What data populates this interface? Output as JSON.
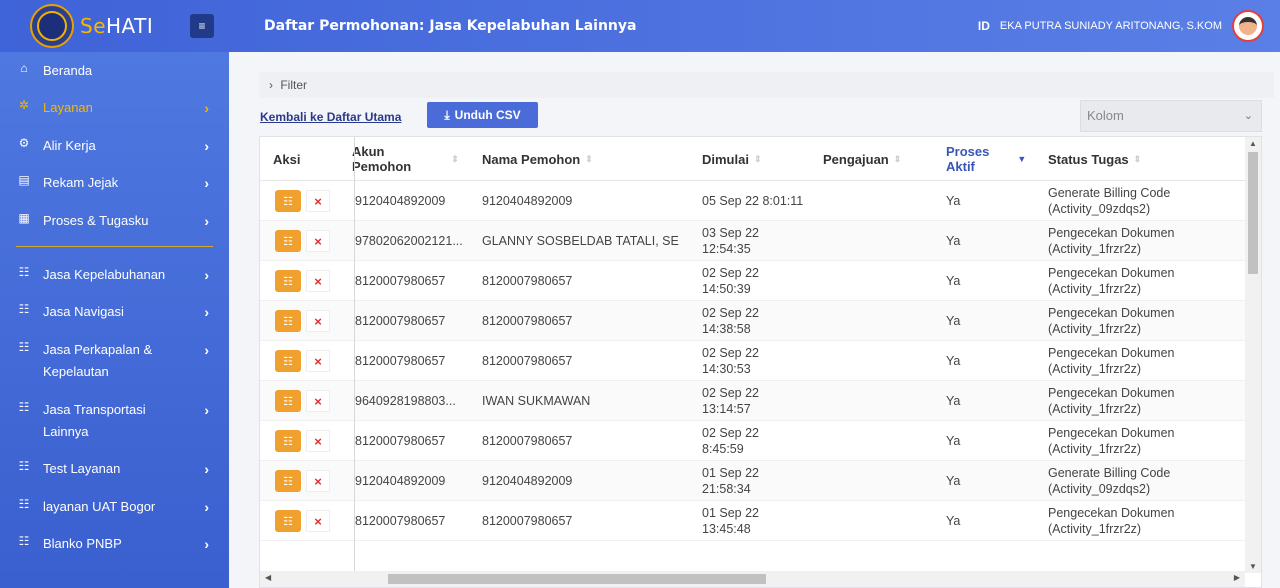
{
  "brand": {
    "prefix": "Se",
    "suffix": "HATI"
  },
  "header": {
    "title": "Daftar Permohonan: Jasa Kepelabuhan Lainnya",
    "lang": "ID",
    "user_name": "EKA PUTRA SUNIADY ARITONANG, S.KOM",
    "toggle_icon": "≡"
  },
  "sidebar": {
    "items": [
      {
        "label": "Beranda",
        "icon": "home-icon",
        "glyph": "⌂",
        "chevron": false
      },
      {
        "label": "Layanan",
        "icon": "spark-icon",
        "glyph": "✲",
        "chevron": true,
        "active": true
      },
      {
        "label": "Alir Kerja",
        "icon": "gear-icon",
        "glyph": "⚙",
        "chevron": true
      },
      {
        "label": "Rekam Jejak",
        "icon": "document-icon",
        "glyph": "▤",
        "chevron": true
      },
      {
        "label": "Proses & Tugasku",
        "icon": "calendar-icon",
        "glyph": "▦",
        "chevron": true
      },
      {
        "label": "Jasa Kepelabuhanan",
        "icon": "list-icon",
        "glyph": "☷",
        "chevron": true
      },
      {
        "label": "Jasa Navigasi",
        "icon": "list-icon",
        "glyph": "☷",
        "chevron": true
      },
      {
        "label": "Jasa Perkapalan & Kepelautan",
        "icon": "list-icon",
        "glyph": "☷",
        "chevron": true
      },
      {
        "label": "Jasa Transportasi Lainnya",
        "icon": "list-icon",
        "glyph": "☷",
        "chevron": true
      },
      {
        "label": "Test Layanan",
        "icon": "list-icon",
        "glyph": "☷",
        "chevron": true
      },
      {
        "label": "layanan UAT Bogor",
        "icon": "list-icon",
        "glyph": "☷",
        "chevron": true
      },
      {
        "label": "Blanko PNBP",
        "icon": "list-icon",
        "glyph": "☷",
        "chevron": true
      }
    ],
    "chevron_glyph": "›"
  },
  "toolbar": {
    "filter_label": "Filter",
    "filter_chevron": "›",
    "back_link": "Kembali ke Daftar Utama",
    "csv_button": "Unduh CSV",
    "csv_icon": "⤓",
    "column_select_placeholder": "Kolom",
    "column_select_chevron": "⌄"
  },
  "table": {
    "headers": {
      "aksi": "Aksi",
      "akun_line1": "Akun",
      "akun_line2": "Pemohon",
      "nama": "Nama Pemohon",
      "dimulai": "Dimulai",
      "pengajuan": "Pengajuan",
      "proses_line1": "Proses",
      "proses_line2": "Aktif",
      "status": "Status Tugas",
      "sort_glyph": "⇕",
      "sort_active_glyph": "▼"
    },
    "edit_icon": "☷",
    "delete_icon": "×",
    "rows": [
      {
        "akun": "9120404892009",
        "nama": "9120404892009",
        "dimulai": "05 Sep 22 8:01:11",
        "dimulai2": "",
        "aktif": "Ya",
        "status1": "Generate Billing Code",
        "status2": "(Activity_09zdqs2)"
      },
      {
        "akun": "97802062002121...",
        "nama": "GLANNY SOSBELDAB TATALI, SE",
        "dimulai": "03 Sep 22",
        "dimulai2": "12:54:35",
        "aktif": "Ya",
        "status1": "Pengecekan Dokumen",
        "status2": "(Activity_1frzr2z)"
      },
      {
        "akun": "8120007980657",
        "nama": "8120007980657",
        "dimulai": "02 Sep 22",
        "dimulai2": "14:50:39",
        "aktif": "Ya",
        "status1": "Pengecekan Dokumen",
        "status2": "(Activity_1frzr2z)"
      },
      {
        "akun": "8120007980657",
        "nama": "8120007980657",
        "dimulai": "02 Sep 22",
        "dimulai2": "14:38:58",
        "aktif": "Ya",
        "status1": "Pengecekan Dokumen",
        "status2": "(Activity_1frzr2z)"
      },
      {
        "akun": "8120007980657",
        "nama": "8120007980657",
        "dimulai": "02 Sep 22",
        "dimulai2": "14:30:53",
        "aktif": "Ya",
        "status1": "Pengecekan Dokumen",
        "status2": "(Activity_1frzr2z)"
      },
      {
        "akun": "9640928198803...",
        "nama": "IWAN SUKMAWAN",
        "dimulai": "02 Sep 22",
        "dimulai2": "13:14:57",
        "aktif": "Ya",
        "status1": "Pengecekan Dokumen",
        "status2": "(Activity_1frzr2z)"
      },
      {
        "akun": "8120007980657",
        "nama": "8120007980657",
        "dimulai": "02 Sep 22",
        "dimulai2": "8:45:59",
        "aktif": "Ya",
        "status1": "Pengecekan Dokumen",
        "status2": "(Activity_1frzr2z)"
      },
      {
        "akun": "9120404892009",
        "nama": "9120404892009",
        "dimulai": "01 Sep 22",
        "dimulai2": "21:58:34",
        "aktif": "Ya",
        "status1": "Generate Billing Code",
        "status2": "(Activity_09zdqs2)"
      },
      {
        "akun": "8120007980657",
        "nama": "8120007980657",
        "dimulai": "01 Sep 22",
        "dimulai2": "13:45:48",
        "aktif": "Ya",
        "status1": "Pengecekan Dokumen",
        "status2": "(Activity_1frzr2z)"
      }
    ]
  },
  "colors": {
    "accent": "#4a6bd8",
    "edit": "#f0a02e",
    "delete": "#e03030",
    "active_nav": "#f5b800"
  }
}
